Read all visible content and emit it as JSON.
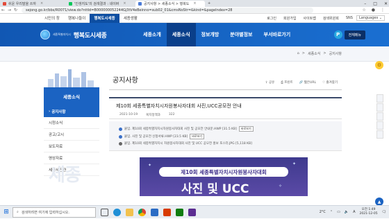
{
  "browser": {
    "tabs": [
      {
        "label": "쉬운 우리말을 쓰자"
      },
      {
        "label": "'인생지도'의 검색결과 : 네이버"
      },
      {
        "label": "공지사항 > 세종소식 > 행복도"
      }
    ],
    "url": "sejong.go.kr/bbs/R0071/view.do?nttId=B000000052244Gj3tV4eBeinno=sub02_01&cmsNoStr=&kind=&pageIndex=28",
    "window_controls": [
      "–",
      "□",
      "✕"
    ]
  },
  "utility_bar": {
    "site_links": [
      "시민의 창",
      "행복나들이",
      "행복도시세종",
      "세종생활"
    ],
    "active_site": "행복도시세종",
    "right_links": [
      "로그인",
      "회원가입",
      "사이트맵",
      "검색위원회",
      "SNS"
    ],
    "language": "Languages"
  },
  "header": {
    "logo_small": "세종특별자치시",
    "logo_big": "행복도시세종",
    "menu": [
      "세종소개",
      "세종소식",
      "정보개방",
      "분야별정보",
      "부서바로가기"
    ],
    "active_menu": "세종소식",
    "p_icon": "P",
    "all_menu": "전체메뉴"
  },
  "breadcrumb": [
    "⌂",
    ">",
    "세종소식",
    ">",
    "공지사항"
  ],
  "sidebar": {
    "title": "세종소식",
    "items": [
      "공지사항",
      "시정소식",
      "공고/고시",
      "보도자료",
      "영상자료",
      "세종사진관"
    ],
    "active_item": "공지사항",
    "watermark": "세종"
  },
  "content": {
    "page_title": "공지사항",
    "tools": [
      "공유",
      "프린트",
      "짧은URL",
      "즐겨찾기"
    ],
    "post": {
      "title": "제10회 세종특별자치시자원봉사자대회 사진,UCC공모전 안내",
      "date": "2021-10-19",
      "department": "복지정책과",
      "views": "322"
    },
    "attachments": [
      {
        "name": "붙임. 제10회 세종특별자치시자원봉사자대회 사진 및 공모전 안내문.HWP [31.5 KB]",
        "button": "바로보기"
      },
      {
        "name": "붙임. 사진 및 공모전 신청서류.HWP [23.5 KB]",
        "button": "바로보기"
      },
      {
        "name": "붙임. 제10회 세종특별자치시 자원봉사자대회 사진 및 UCC 공모전 홍보 포스터.JPG [5,118 KB]",
        "button": ""
      }
    ],
    "poster": {
      "band": "제10회 세종특별자치시자원봉사자대회",
      "big": "사진 및 UCC"
    }
  },
  "taskbar": {
    "search_placeholder": "검색하려면 여기에 입력하십시오.",
    "weather": "2°C",
    "ime": "A",
    "time": "오전 1:49",
    "date": "2021-12-05"
  }
}
